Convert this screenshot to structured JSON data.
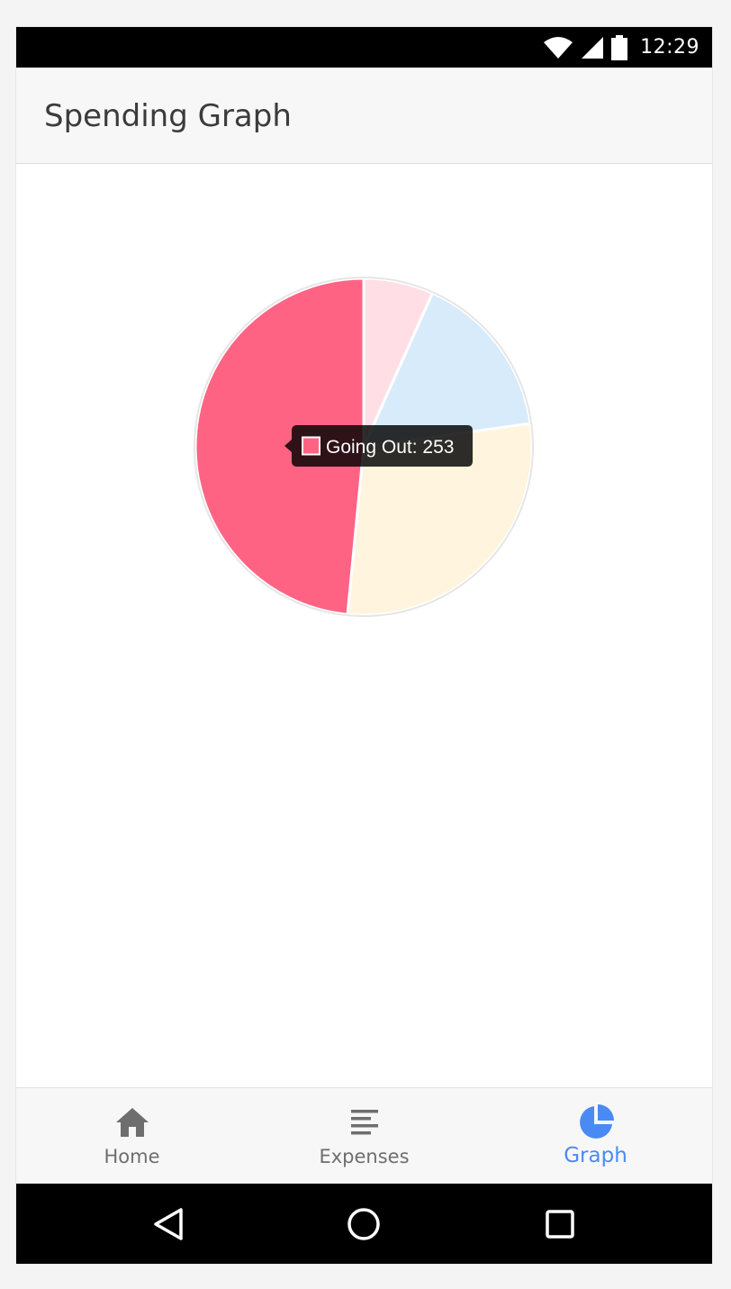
{
  "status_bar": {
    "time": "12:29"
  },
  "header": {
    "title": "Spending Graph"
  },
  "chart_data": {
    "type": "pie",
    "slices": [
      {
        "value": 35,
        "color": "#ffdfe5"
      },
      {
        "value": 84,
        "color": "#d8ebfa"
      },
      {
        "value": 150,
        "color": "#fff4dd"
      },
      {
        "label": "Going Out",
        "value": 253,
        "color": "#ff6384"
      }
    ],
    "tooltip": {
      "label": "Going Out",
      "value": 253,
      "text": "Going Out: 253"
    }
  },
  "tabs": [
    {
      "label": "Home",
      "icon": "home-icon",
      "active": false
    },
    {
      "label": "Expenses",
      "icon": "list-icon",
      "active": false
    },
    {
      "label": "Graph",
      "icon": "pie-chart-icon",
      "active": true
    }
  ],
  "colors": {
    "accent": "#4a8af4",
    "inactive": "#6e6e6e",
    "highlight": "#ff6384"
  }
}
